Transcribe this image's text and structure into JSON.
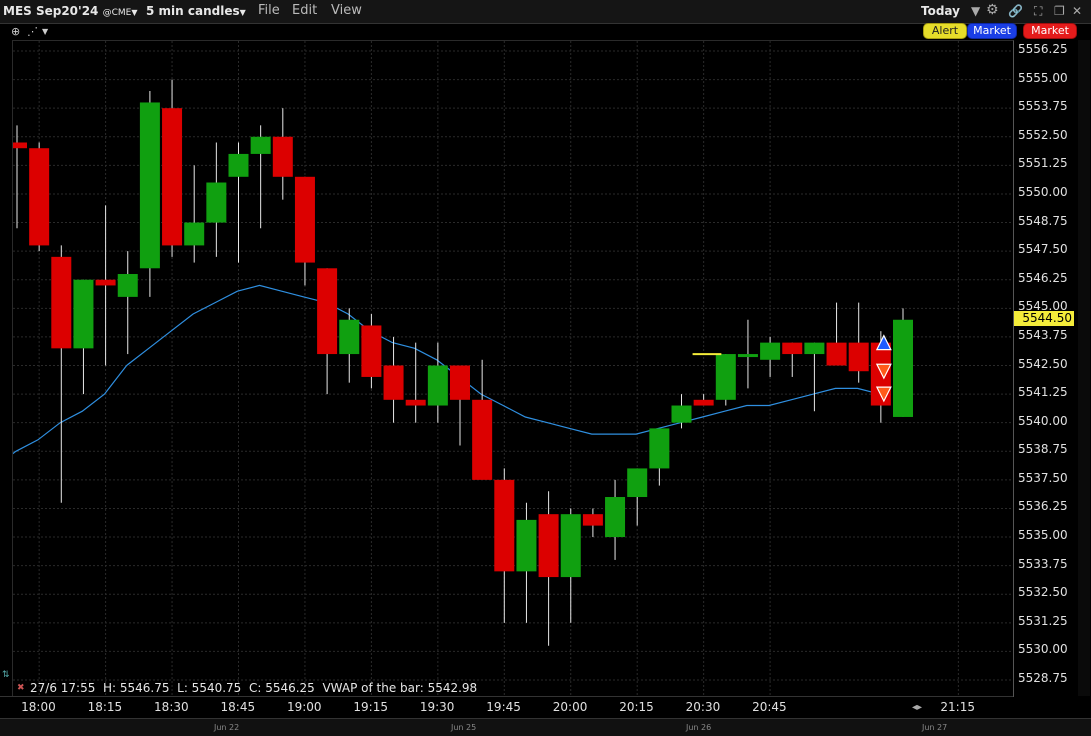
{
  "toolbar": {
    "symbol": "MES Sep20'24",
    "exchange": "@CME",
    "interval": "5 min candles",
    "menu_file": "File",
    "menu_edit": "Edit",
    "menu_view": "View",
    "range": "Today"
  },
  "order_buttons": {
    "alert": "Alert",
    "buy": "Market",
    "sell": "Market"
  },
  "price_axis": {
    "labels": [
      "5556.25",
      "5555.00",
      "5553.75",
      "5552.50",
      "5551.25",
      "5550.00",
      "5548.75",
      "5547.50",
      "5546.25",
      "5545.00",
      "5543.75",
      "5542.50",
      "5541.25",
      "5540.00",
      "5538.75",
      "5537.50",
      "5536.25",
      "5535.00",
      "5533.75",
      "5532.50",
      "5531.25",
      "5530.00",
      "5528.75"
    ],
    "last_price": "5544.50"
  },
  "time_axis": {
    "labels": [
      "18:00",
      "18:15",
      "18:30",
      "18:45",
      "19:00",
      "19:15",
      "19:30",
      "19:45",
      "20:00",
      "20:15",
      "20:30",
      "20:45",
      "21:15"
    ],
    "date_labels": [
      "Jun 22",
      "Jun 25",
      "Jun 26",
      "Jun 27"
    ]
  },
  "info_bar": {
    "datetime": "27/6 17:55",
    "high": "H: 5546.75",
    "low": "L: 5540.75",
    "close": "C: 5546.25",
    "vwap": "VWAP of the bar: 5542.98"
  },
  "colors": {
    "up": "#10a010",
    "down": "#dc0000",
    "vwap_line": "#2f8fe0",
    "grid": "#2a2a2a",
    "marker_buy": "#1e5bff",
    "marker_sell": "#ff5a1a"
  },
  "chart_data": {
    "type": "candlestick",
    "ylim": [
      5528.0,
      5556.5
    ],
    "candles": [
      {
        "t": "17:55",
        "o": 5552.25,
        "h": 5553.0,
        "l": 5548.5,
        "c": 5552.0
      },
      {
        "t": "18:00",
        "o": 5552.0,
        "h": 5552.25,
        "l": 5547.5,
        "c": 5547.75
      },
      {
        "t": "18:05",
        "o": 5547.25,
        "h": 5547.75,
        "l": 5536.5,
        "c": 5543.25
      },
      {
        "t": "18:10",
        "o": 5543.25,
        "h": 5546.25,
        "l": 5541.25,
        "c": 5546.25
      },
      {
        "t": "18:15",
        "o": 5546.25,
        "h": 5549.5,
        "l": 5542.5,
        "c": 5546.0
      },
      {
        "t": "18:20",
        "o": 5545.5,
        "h": 5547.5,
        "l": 5543.0,
        "c": 5546.5
      },
      {
        "t": "18:25",
        "o": 5546.75,
        "h": 5554.5,
        "l": 5545.5,
        "c": 5554.0
      },
      {
        "t": "18:30",
        "o": 5553.75,
        "h": 5555.0,
        "l": 5547.25,
        "c": 5547.75
      },
      {
        "t": "18:35",
        "o": 5547.75,
        "h": 5551.25,
        "l": 5547.0,
        "c": 5548.75
      },
      {
        "t": "18:40",
        "o": 5548.75,
        "h": 5552.25,
        "l": 5547.25,
        "c": 5550.5
      },
      {
        "t": "18:45",
        "o": 5550.75,
        "h": 5552.25,
        "l": 5547.0,
        "c": 5551.75
      },
      {
        "t": "18:50",
        "o": 5551.75,
        "h": 5553.0,
        "l": 5548.5,
        "c": 5552.5
      },
      {
        "t": "18:55",
        "o": 5552.5,
        "h": 5553.75,
        "l": 5549.75,
        "c": 5550.75
      },
      {
        "t": "19:00",
        "o": 5550.75,
        "h": 5550.75,
        "l": 5546.0,
        "c": 5547.0
      },
      {
        "t": "19:05",
        "o": 5546.75,
        "h": 5546.75,
        "l": 5541.25,
        "c": 5543.0
      },
      {
        "t": "19:10",
        "o": 5543.0,
        "h": 5545.0,
        "l": 5541.75,
        "c": 5544.5
      },
      {
        "t": "19:15",
        "o": 5544.25,
        "h": 5544.75,
        "l": 5541.5,
        "c": 5542.0
      },
      {
        "t": "19:20",
        "o": 5542.5,
        "h": 5543.75,
        "l": 5540.0,
        "c": 5541.0
      },
      {
        "t": "19:25",
        "o": 5541.0,
        "h": 5543.5,
        "l": 5540.0,
        "c": 5540.75
      },
      {
        "t": "19:30",
        "o": 5540.75,
        "h": 5543.5,
        "l": 5540.0,
        "c": 5542.5
      },
      {
        "t": "19:35",
        "o": 5542.5,
        "h": 5542.5,
        "l": 5539.0,
        "c": 5541.0
      },
      {
        "t": "19:40",
        "o": 5541.0,
        "h": 5542.75,
        "l": 5538.5,
        "c": 5537.5
      },
      {
        "t": "19:45",
        "o": 5537.5,
        "h": 5538.0,
        "l": 5531.25,
        "c": 5533.5
      },
      {
        "t": "19:50",
        "o": 5533.5,
        "h": 5536.5,
        "l": 5531.25,
        "c": 5535.75
      },
      {
        "t": "19:55",
        "o": 5536.0,
        "h": 5537.0,
        "l": 5530.25,
        "c": 5533.25
      },
      {
        "t": "20:00",
        "o": 5533.25,
        "h": 5536.25,
        "l": 5531.25,
        "c": 5536.0
      },
      {
        "t": "20:05",
        "o": 5536.0,
        "h": 5536.25,
        "l": 5535.0,
        "c": 5535.5
      },
      {
        "t": "20:10",
        "o": 5535.0,
        "h": 5537.5,
        "l": 5534.0,
        "c": 5536.75
      },
      {
        "t": "20:15",
        "o": 5536.75,
        "h": 5538.0,
        "l": 5535.5,
        "c": 5538.0
      },
      {
        "t": "20:20",
        "o": 5538.0,
        "h": 5539.5,
        "l": 5537.25,
        "c": 5539.75
      },
      {
        "t": "20:25",
        "o": 5540.0,
        "h": 5541.25,
        "l": 5539.75,
        "c": 5540.75
      },
      {
        "t": "20:30",
        "o": 5541.0,
        "h": 5541.25,
        "l": 5540.75,
        "c": 5540.75
      },
      {
        "t": "20:35",
        "o": 5541.0,
        "h": 5543.0,
        "l": 5540.75,
        "c": 5543.0
      },
      {
        "t": "20:40",
        "o": 5543.0,
        "h": 5544.5,
        "l": 5541.5,
        "c": 5543.0
      },
      {
        "t": "20:45",
        "o": 5542.75,
        "h": 5543.75,
        "l": 5542.0,
        "c": 5543.5
      },
      {
        "t": "20:50",
        "o": 5543.5,
        "h": 5543.5,
        "l": 5542.0,
        "c": 5543.0
      },
      {
        "t": "20:55",
        "o": 5543.0,
        "h": 5543.5,
        "l": 5540.5,
        "c": 5543.5
      },
      {
        "t": "21:00",
        "o": 5543.5,
        "h": 5545.25,
        "l": 5542.5,
        "c": 5542.5
      },
      {
        "t": "21:05",
        "o": 5543.5,
        "h": 5545.25,
        "l": 5541.75,
        "c": 5542.25
      },
      {
        "t": "21:10",
        "o": 5543.5,
        "h": 5544.0,
        "l": 5540.0,
        "c": 5540.75
      },
      {
        "t": "21:15",
        "o": 5540.25,
        "h": 5545.0,
        "l": 5540.25,
        "c": 5544.5
      }
    ],
    "vwap": [
      5538.0,
      5538.75,
      5539.25,
      5540.0,
      5540.5,
      5541.25,
      5542.5,
      5543.25,
      5544.0,
      5544.75,
      5545.25,
      5545.75,
      5546.0,
      5545.75,
      5545.5,
      5545.25,
      5544.75,
      5544.0,
      5543.5,
      5543.25,
      5542.75,
      5542.0,
      5541.25,
      5540.75,
      5540.25,
      5540.0,
      5539.75,
      5539.5,
      5539.5,
      5539.5,
      5539.75,
      5540.0,
      5540.25,
      5540.5,
      5540.75,
      5540.75,
      5541.0,
      5541.25,
      5541.5,
      5541.5,
      5541.25
    ],
    "markers": [
      {
        "type": "buy",
        "index": 39,
        "price": 5543.5
      },
      {
        "type": "sell",
        "index": 39,
        "price": 5542.25
      },
      {
        "type": "sell",
        "index": 39,
        "price": 5541.25
      }
    ]
  }
}
